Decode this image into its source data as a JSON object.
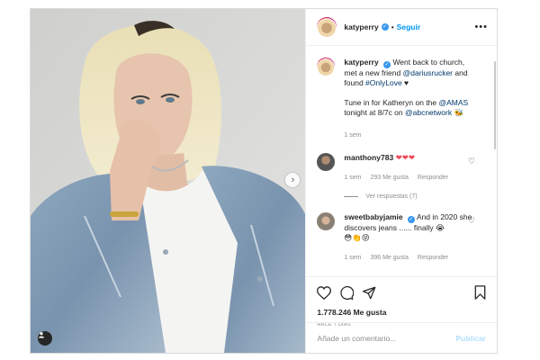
{
  "post": {
    "username": "katyperry",
    "follow_label": "Seguir",
    "more_icon": "more-options-icon",
    "caption": {
      "username": "katyperry",
      "parts": [
        "Went back to church, met a new friend ",
        "@dariusrucker",
        " and found ",
        "#OnlyLove",
        " ♥",
        "Tune in for Katheryn on the ",
        "@AMAS",
        " tonight at 8/7c on ",
        "@abcnetwork",
        " 🐝"
      ],
      "time": "1 sem"
    },
    "comments": [
      {
        "username": "manthony783",
        "text": "❤❤❤",
        "time": "1 sem",
        "likes": "293 Me gusta",
        "reply": "Responder",
        "view_replies": "Ver respuestas (7)"
      },
      {
        "username": "sweetbabyjamie",
        "text": "And in 2020 she discovers jeans ...... finally 😭",
        "text2": "😳👏😝",
        "time": "1 sem",
        "likes": "396 Me gusta",
        "reply": "Responder"
      }
    ],
    "likes": "1.778.246 Me gusta",
    "posted_ago": "Hace 7 días",
    "add_comment_placeholder": "Añade un comentario...",
    "publish_label": "Publicar"
  },
  "colors": {
    "link": "#00376b",
    "accent": "#0095f6",
    "verified": "#3897f0",
    "muted": "#8e8e8e"
  }
}
